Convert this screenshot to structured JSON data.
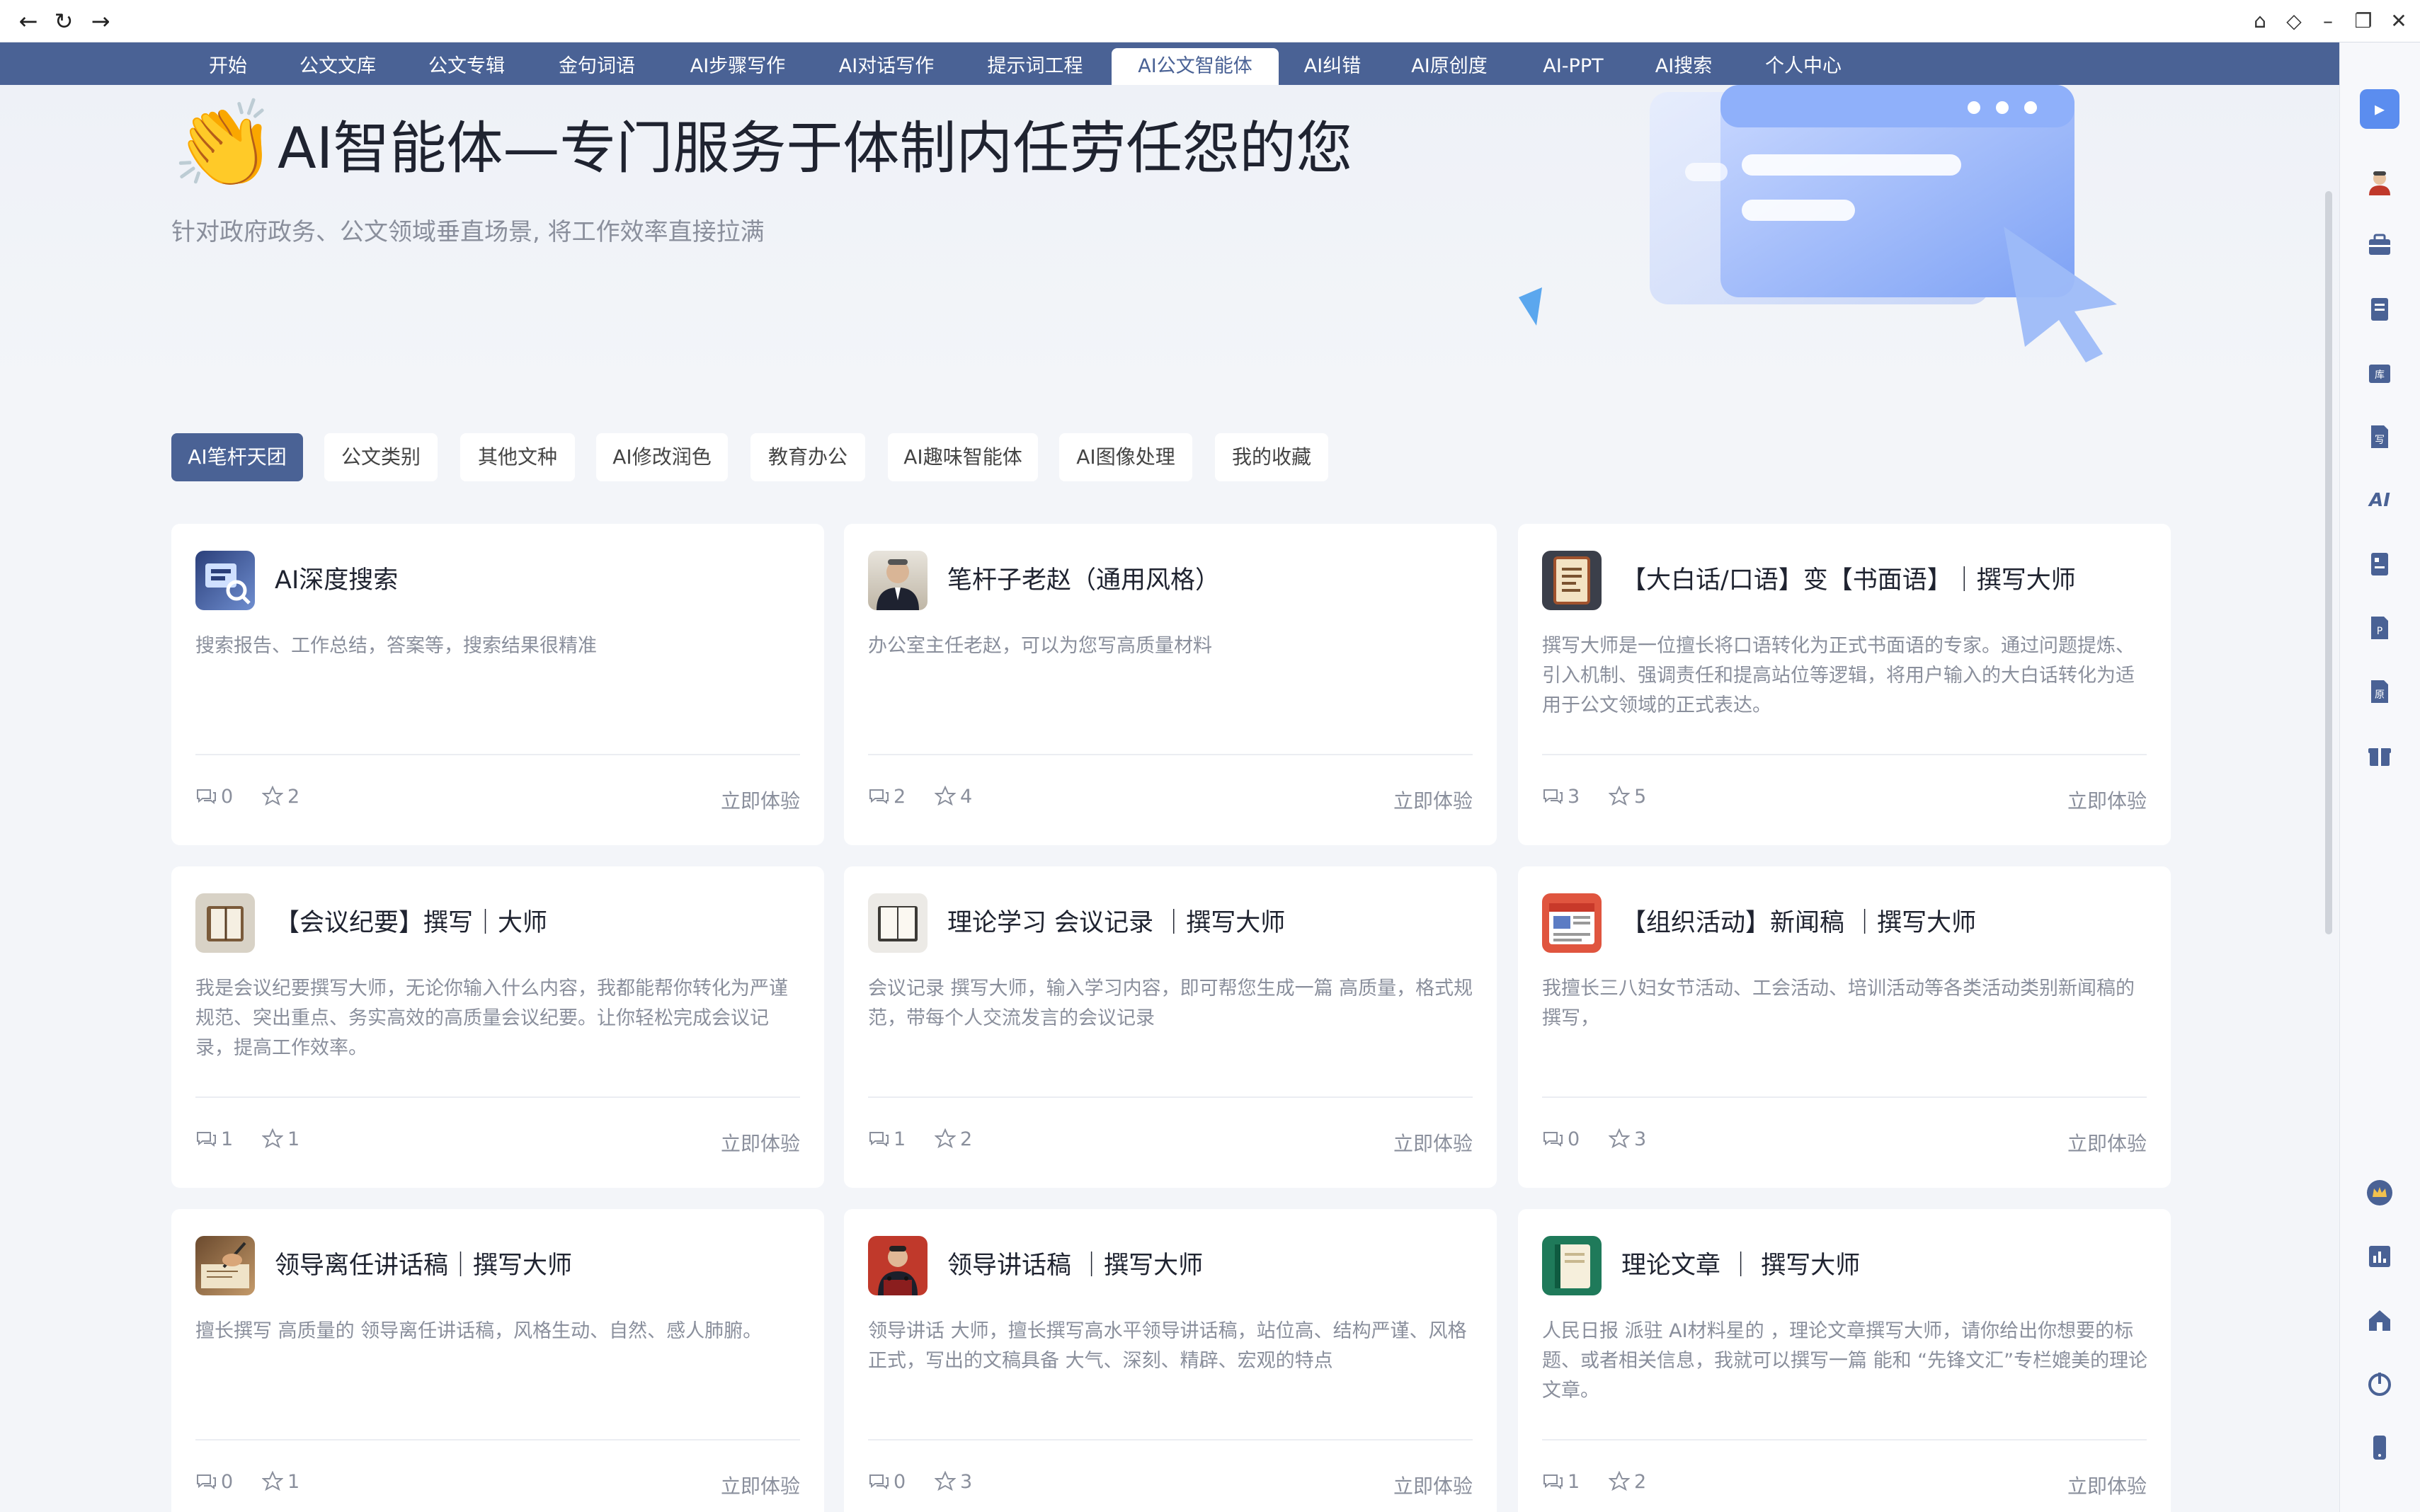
{
  "nav": {
    "tabs": [
      {
        "label": "开始"
      },
      {
        "label": "公文文库"
      },
      {
        "label": "公文专辑"
      },
      {
        "label": "金句词语"
      },
      {
        "label": "AI步骤写作"
      },
      {
        "label": "AI对话写作"
      },
      {
        "label": "提示词工程"
      },
      {
        "label": "AI公文智能体"
      },
      {
        "label": "AI纠错"
      },
      {
        "label": "AI原创度"
      },
      {
        "label": "AI-PPT"
      },
      {
        "label": "AI搜索"
      },
      {
        "label": "个人中心"
      }
    ],
    "active_tab": "AI公文智能体"
  },
  "hero": {
    "emoji": "👏",
    "title": "AI智能体—专门服务于体制内任劳任怨的您",
    "subtitle": "针对政府政务、公文领域垂直场景, 将工作效率直接拉满"
  },
  "categories": [
    {
      "label": "AI笔杆天团"
    },
    {
      "label": "公文类别"
    },
    {
      "label": "其他文种"
    },
    {
      "label": "AI修改润色"
    },
    {
      "label": "教育办公"
    },
    {
      "label": "AI趣味智能体"
    },
    {
      "label": "AI图像处理"
    },
    {
      "label": "我的收藏"
    }
  ],
  "active_category": "AI笔杆天团",
  "cta_label": "立即体验",
  "cards": [
    {
      "title": "AI深度搜索",
      "desc": "搜索报告、工作总结，答案等，搜索结果很精准",
      "comments": "0",
      "stars": "2",
      "avatar": "search-avatar-icon"
    },
    {
      "title": "笔杆子老赵（通用风格）",
      "desc": "办公室主任老赵，可以为您写高质量材料",
      "comments": "2",
      "stars": "4",
      "avatar": "portrait-avatar-icon"
    },
    {
      "title": "【大白话/口语】变【书面语】｜撰写大师",
      "desc": "撰写大师是一位擅长将口语转化为正式书面语的专家。通过问题提炼、引入机制、强调责任和提高站位等逻辑，将用户输入的大白话转化为适用于公文领域的正式表达。",
      "comments": "3",
      "stars": "5",
      "avatar": "document-avatar-icon"
    },
    {
      "title": "【会议纪要】撰写｜大师",
      "desc": "我是会议纪要撰写大师，无论你输入什么内容，我都能帮你转化为严谨规范、突出重点、务实高效的高质量会议纪要。让你轻松完成会议记录，提高工作效率。",
      "comments": "1",
      "stars": "1",
      "avatar": "book-avatar-icon"
    },
    {
      "title": "理论学习 会议记录 ｜撰写大师",
      "desc": "会议记录 撰写大师，输入学习内容，即可帮您生成一篇 高质量，格式规范，带每个人交流发言的会议记录",
      "comments": "1",
      "stars": "2",
      "avatar": "open-book-avatar-icon"
    },
    {
      "title": "【组织活动】新闻稿 ｜撰写大师",
      "desc": "我擅长三八妇女节活动、工会活动、培训活动等各类活动类别新闻稿的撰写，",
      "comments": "0",
      "stars": "3",
      "avatar": "newspaper-avatar-icon"
    },
    {
      "title": "领导离任讲话稿｜撰写大师",
      "desc": "擅长撰写 高质量的 领导离任讲话稿，风格生动、自然、感人肺腑。",
      "comments": "0",
      "stars": "1",
      "avatar": "writing-hand-avatar-icon"
    },
    {
      "title": "领导讲话稿 ｜撰写大师",
      "desc": "领导讲话 大师，擅长撰写高水平领导讲话稿，站位高、结构严谨、风格正式，写出的文稿具备 大气、深刻、精辟、宏观的特点",
      "comments": "0",
      "stars": "3",
      "avatar": "speaker-avatar-icon"
    },
    {
      "title": "理论文章 ｜ 撰写大师",
      "desc": "人民日报 派驻 AI材料星的 ，理论文章撰写大师，请你给出你想要的标题、或者相关信息，我就可以撰写一篇 能和 “先锋文汇”专栏媲美的理论文章。",
      "comments": "1",
      "stars": "2",
      "avatar": "notebook-avatar-icon"
    }
  ],
  "colors": {
    "brand": "#4a6295",
    "muted": "#8a8f9c"
  }
}
